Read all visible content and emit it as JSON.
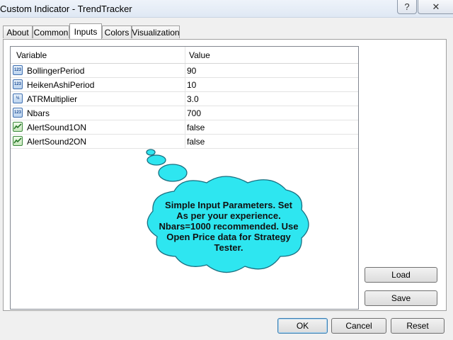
{
  "window": {
    "title": "Custom Indicator - TrendTracker",
    "help_label": "?",
    "close_label": "✕"
  },
  "tabs": [
    {
      "label": "About"
    },
    {
      "label": "Common"
    },
    {
      "label": "Inputs",
      "active": true
    },
    {
      "label": "Colors"
    },
    {
      "label": "Visualization"
    }
  ],
  "table": {
    "columns": [
      "Variable",
      "Value"
    ],
    "rows": [
      {
        "icon": "int-icon",
        "icon_text": "123",
        "name": "BollingerPeriod",
        "value": "90"
      },
      {
        "icon": "int-icon",
        "icon_text": "123",
        "name": "HeikenAshiPeriod",
        "value": "10"
      },
      {
        "icon": "double-icon",
        "icon_text": "½",
        "name": "ATRMultiplier",
        "value": "3.0"
      },
      {
        "icon": "int-icon",
        "icon_text": "123",
        "name": "Nbars",
        "value": "700"
      },
      {
        "icon": "bool-icon",
        "icon_text": "",
        "name": "AlertSound1ON",
        "value": "false"
      },
      {
        "icon": "bool-icon",
        "icon_text": "",
        "name": "AlertSound2ON",
        "value": "false"
      }
    ]
  },
  "callout": {
    "lines": [
      "Simple Input Parameters. Set",
      "As per your experience.",
      "Nbars=1000 recommended. Use",
      "Open Price data for Strategy",
      "Tester."
    ],
    "color": "#2ee6f0"
  },
  "buttons": {
    "load": "Load",
    "save": "Save",
    "ok": "OK",
    "cancel": "Cancel",
    "reset": "Reset"
  }
}
